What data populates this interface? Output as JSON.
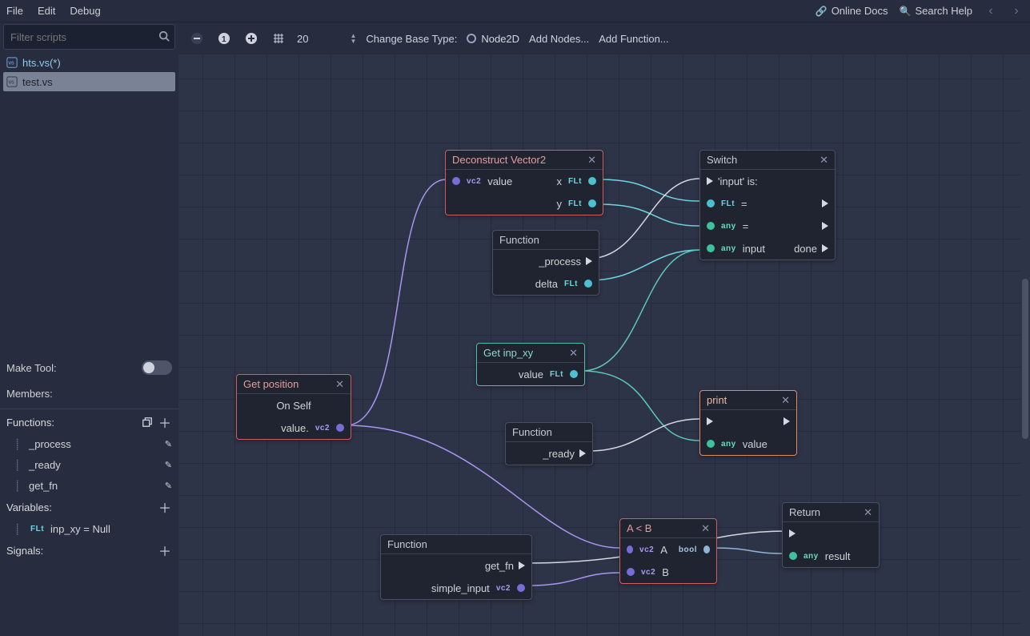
{
  "menu": {
    "file": "File",
    "edit": "Edit",
    "debug": "Debug",
    "online_docs": "Online Docs",
    "search_help": "Search Help"
  },
  "filter_placeholder": "Filter scripts",
  "scripts": [
    {
      "name": "hts.vs(*)",
      "active": false
    },
    {
      "name": "test.vs",
      "active": true
    }
  ],
  "make_tool_label": "Make Tool:",
  "members_label": "Members:",
  "functions_label": "Functions:",
  "variables_label": "Variables:",
  "signals_label": "Signals:",
  "functions": [
    {
      "name": "_process"
    },
    {
      "name": "_ready"
    },
    {
      "name": "get_fn"
    }
  ],
  "variables": [
    {
      "type": "FLt",
      "text": "inp_xy = Null"
    }
  ],
  "toolbar": {
    "zoom": "20",
    "change_base": "Change Base Type:",
    "base_type": "Node2D",
    "add_nodes": "Add Nodes...",
    "add_function": "Add Function..."
  },
  "nodes": {
    "deconstruct": {
      "title": "Deconstruct Vector2",
      "in": "value",
      "out_x": "x",
      "out_y": "y"
    },
    "switch": {
      "title": "Switch",
      "sub": "'input' is:",
      "eq1": "=",
      "eq2": "=",
      "input": "input",
      "done": "done"
    },
    "func_process": {
      "title": "Function",
      "proc": "_process",
      "delta": "delta"
    },
    "get_inp": {
      "title": "Get inp_xy",
      "value": "value"
    },
    "get_pos": {
      "title": "Get position",
      "on_self": "On Self",
      "value": "value."
    },
    "func_ready": {
      "title": "Function",
      "ready": "_ready"
    },
    "print": {
      "title": "print",
      "value": "value"
    },
    "func_getfn": {
      "title": "Function",
      "get_fn": "get_fn",
      "simple": "simple_input"
    },
    "aleb": {
      "title": "A < B",
      "a": "A",
      "b": "B"
    },
    "return": {
      "title": "Return",
      "result": "result"
    }
  }
}
